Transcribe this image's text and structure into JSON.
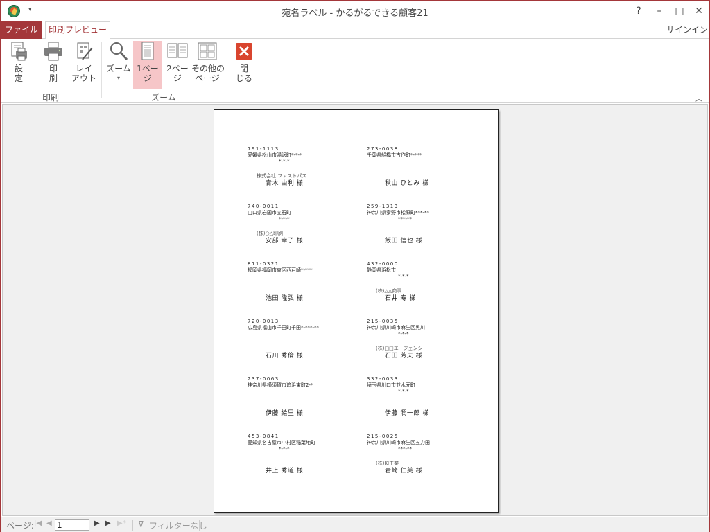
{
  "window": {
    "title": "宛名ラベル - かるがるできる顧客21",
    "signin": "サインイン",
    "help_icon": "?",
    "minimize_icon": "–",
    "restore_icon": "□",
    "close_icon": "✕"
  },
  "tabs": {
    "file": "ファイル",
    "print_preview": "印刷プレビュー"
  },
  "ribbon": {
    "buttons": {
      "settings": "設\n定",
      "print": "印\n刷",
      "layout": "レイ\nアウト",
      "zoom": "ズーム",
      "one_page": "1ペー\nジ",
      "two_pages": "2ペー\nジ",
      "other_pages": "その他の\nページ",
      "close": "閉\nじる"
    },
    "groups": {
      "print": "印刷",
      "zoom": "ズーム"
    },
    "active_button": "one_page"
  },
  "labels": [
    {
      "zip": "791-1113",
      "addr1": "愛媛県松山市湯沢町*-*-*",
      "addr2": "*-*-*",
      "company": "株式会社 ファストパス",
      "name": "青木 由利 様"
    },
    {
      "zip": "273-0038",
      "addr1": "千葉県船橋市古作町*-***",
      "addr2": "",
      "company": "",
      "name": "秋山 ひとみ 様"
    },
    {
      "zip": "740-0011",
      "addr1": "山口県岩国市立石町",
      "addr2": "*-*-*",
      "company": "(株)○△印刷",
      "name": "安部 幸子 様"
    },
    {
      "zip": "259-1313",
      "addr1": "神奈川県秦野市松原町***-**",
      "addr2": "***-**",
      "company": "",
      "name": "飯田 信也 様"
    },
    {
      "zip": "811-0321",
      "addr1": "福岡県福岡市東区西戸崎*-***",
      "addr2": "",
      "company": "",
      "name": "池田 隆弘 様"
    },
    {
      "zip": "432-0000",
      "addr1": "静岡県浜松市",
      "addr2": "*-*-*",
      "company": "(株)△△商事",
      "name": "石井 寿 様"
    },
    {
      "zip": "720-0013",
      "addr1": "広島県福山市千田町千田*-***-**",
      "addr2": "",
      "company": "",
      "name": "石川 秀倫 様"
    },
    {
      "zip": "215-0035",
      "addr1": "神奈川県川崎市麻生区黒川",
      "addr2": "*-*-*",
      "company": "(株)□□エージェンシー",
      "name": "石田 芳夫 様"
    },
    {
      "zip": "237-0063",
      "addr1": "神奈川県横須賀市追浜東町2-*",
      "addr2": "",
      "company": "",
      "name": "伊藤 絵里 様"
    },
    {
      "zip": "332-0033",
      "addr1": "埼玉県川口市並木元町",
      "addr2": "*-*-*",
      "company": "",
      "name": "伊藤 潤一郎 様"
    },
    {
      "zip": "453-0841",
      "addr1": "愛知県名古屋市中村区稲葉地町",
      "addr2": "*-*-*",
      "company": "",
      "name": "井上 秀道 様"
    },
    {
      "zip": "215-0025",
      "addr1": "神奈川県川崎市麻生区五力田",
      "addr2": "***-**",
      "company": "(株)KI工業",
      "name": "岩崎 仁美 様"
    }
  ],
  "statusbar": {
    "page_label": "ページ:",
    "page_value": "1",
    "filter_label": "フィルターなし"
  },
  "colors": {
    "accent": "#a4373a",
    "active_button": "#f6c6c8"
  }
}
